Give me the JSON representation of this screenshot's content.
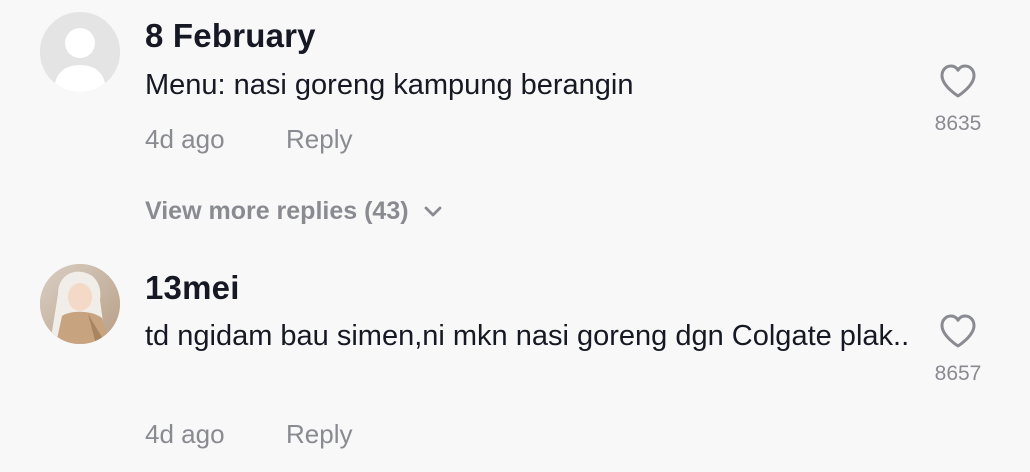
{
  "comments": [
    {
      "username": "8 February",
      "text": "Menu: nasi goreng kampung berangin",
      "time": "4d ago",
      "reply_label": "Reply",
      "likes": "8635",
      "avatar": "default-avatar-icon"
    },
    {
      "username": "13mei",
      "text": "td ngidam bau simen,ni mkn nasi goreng dgn Colgate plak..",
      "time": "4d ago",
      "reply_label": "Reply",
      "likes": "8657",
      "avatar": "user-photo"
    }
  ],
  "view_more_replies": "View more replies (43)",
  "colors": {
    "background": "#f8f8f8",
    "primary_text": "#161823",
    "secondary_text": "#8a8b91"
  }
}
